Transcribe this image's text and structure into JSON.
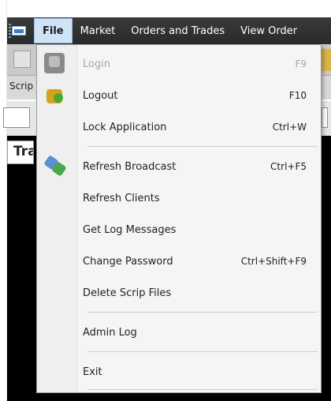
{
  "menubar": {
    "items": [
      {
        "label": "File"
      },
      {
        "label": "Market"
      },
      {
        "label": "Orders and Trades"
      },
      {
        "label": "View Order"
      }
    ]
  },
  "background": {
    "scrip_label": "Scrip",
    "tab_label": "Tra"
  },
  "file_menu": {
    "items": [
      {
        "label": "Login",
        "shortcut": "F9",
        "enabled": false,
        "icon": "login-icon"
      },
      {
        "label": "Logout",
        "shortcut": "F10",
        "enabled": true,
        "icon": "logout-icon"
      },
      {
        "label": "Lock Application",
        "shortcut": "Ctrl+W",
        "enabled": true
      },
      {
        "label": "Refresh Broadcast",
        "shortcut": "Ctrl+F5",
        "enabled": true,
        "icon": "refresh-broadcast-icon"
      },
      {
        "label": "Refresh Clients",
        "shortcut": "",
        "enabled": true
      },
      {
        "label": "Get Log Messages",
        "shortcut": "",
        "enabled": true
      },
      {
        "label": "Change Password",
        "shortcut": "Ctrl+Shift+F9",
        "enabled": true
      },
      {
        "label": "Delete Scrip Files",
        "shortcut": "",
        "enabled": true
      },
      {
        "label": "Admin Log",
        "shortcut": "",
        "enabled": true
      },
      {
        "label": "Exit",
        "shortcut": "",
        "enabled": true
      }
    ]
  },
  "colors": {
    "menubar_bg": "#2e2e2e",
    "menu_active_bg": "#cfe3f6",
    "dropdown_bg": "#f5f5f5",
    "disabled_text": "#a8a8a8"
  }
}
